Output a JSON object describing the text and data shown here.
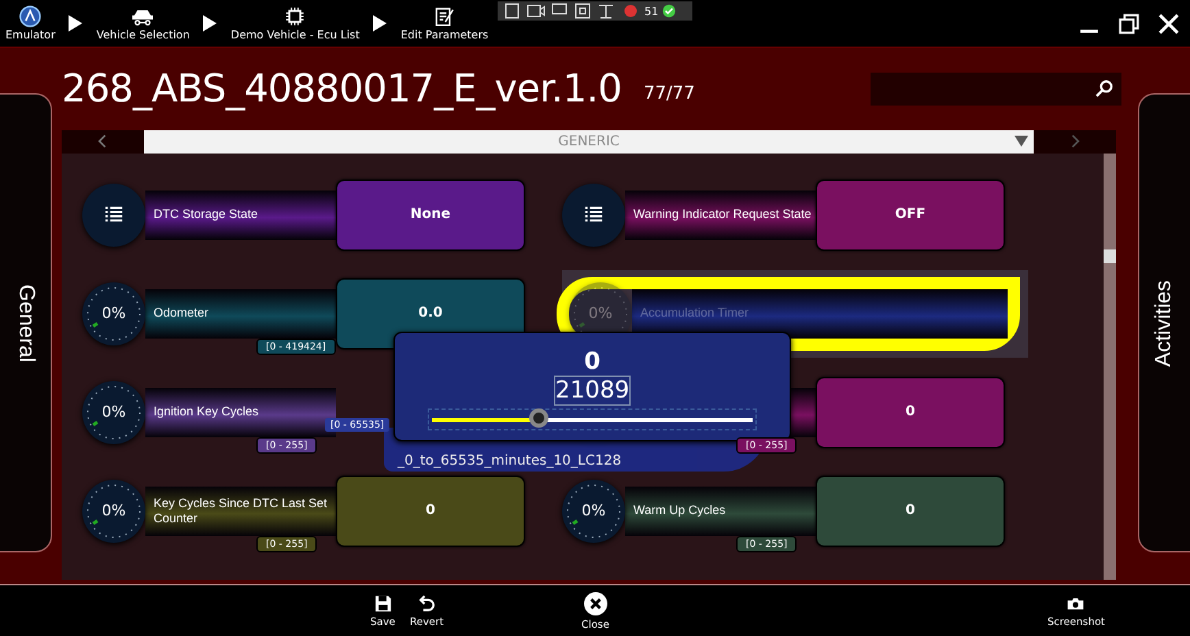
{
  "breadcrumb": [
    {
      "label": "Emulator"
    },
    {
      "label": "Vehicle Selection"
    },
    {
      "label": "Demo Vehicle - Ecu List"
    },
    {
      "label": "Edit Parameters"
    }
  ],
  "status_tray": {
    "count": "51"
  },
  "title": "268_ABS_40880017_E_ver.1.0",
  "counter": "77/77",
  "side_tabs": {
    "left": "General",
    "right": "Activities"
  },
  "group_dropdown": {
    "value": "GENERIC"
  },
  "cards": [
    {
      "kind": "list",
      "label": "DTC Storage State",
      "value": "None",
      "color": "#5a1a8a",
      "selected": false
    },
    {
      "kind": "list",
      "label": "Warning Indicator Request State",
      "value": "OFF",
      "color": "#7a1060",
      "selected": false
    },
    {
      "kind": "gauge",
      "gauge": "0%",
      "label": "Odometer",
      "value": "0.0",
      "range": "[0 - 419424]",
      "color": "#0f4a5a",
      "selected": false
    },
    {
      "kind": "gauge",
      "gauge": "0%",
      "label": "Accumulation Timer",
      "color": "#1c2a80",
      "selected": true
    },
    {
      "kind": "gauge",
      "gauge": "0%",
      "label": "Ignition Key Cycles",
      "range": "[0 - 255]",
      "color": "#5a3a8a",
      "selected": false
    },
    {
      "kind": "gauge",
      "value": "0",
      "range": "[0 - 255]",
      "color": "#7a1060",
      "selected": false
    },
    {
      "kind": "gauge",
      "gauge": "0%",
      "label": "Key Cycles Since DTC Last Set Counter",
      "value": "0",
      "range": "[0 - 255]",
      "color": "#4a4a18",
      "selected": false
    },
    {
      "kind": "gauge",
      "gauge": "0%",
      "label": "Warm Up Cycles",
      "value": "0",
      "range": "[0 - 255]",
      "color": "#2e4a3a",
      "selected": false
    }
  ],
  "editor": {
    "value": "0",
    "input": "21089",
    "level": 0.34,
    "range": "[0 - 65535]",
    "parameter": "_0_to_65535_minutes_10_LC128"
  },
  "bottom_actions": [
    {
      "label": "Save"
    },
    {
      "label": "Revert"
    },
    {
      "label": "Close"
    },
    {
      "label": "Screenshot"
    }
  ]
}
